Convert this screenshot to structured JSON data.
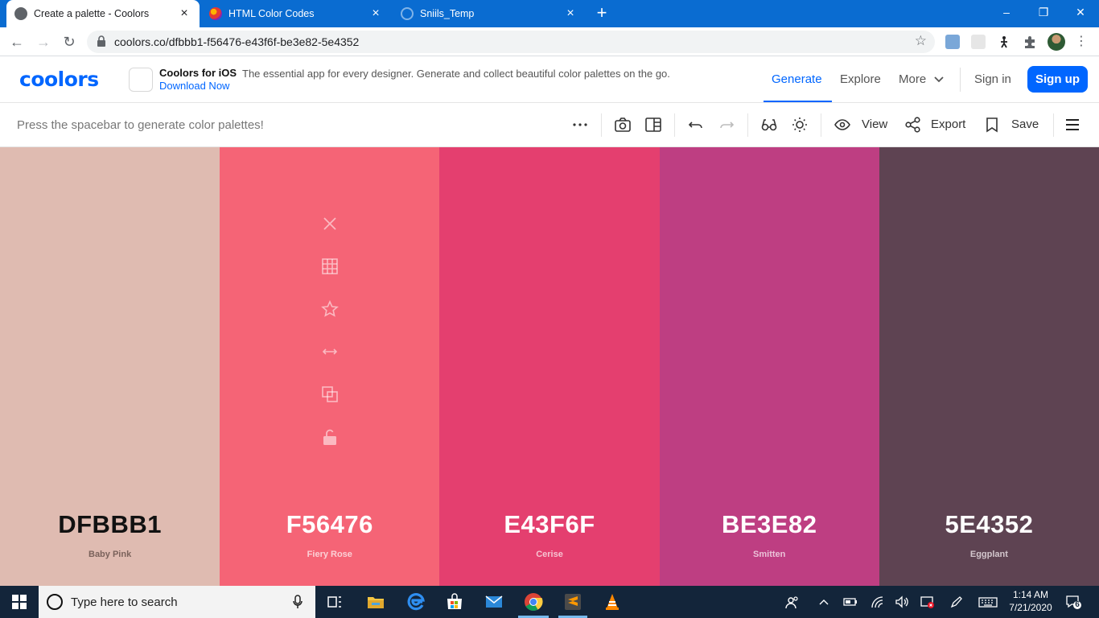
{
  "browser": {
    "tabs": [
      {
        "title": "Create a palette - Coolors",
        "active": true
      },
      {
        "title": "HTML Color Codes",
        "active": false
      },
      {
        "title": "Sniils_Temp",
        "active": false
      }
    ],
    "tab_close": "×",
    "new_tab": "+",
    "window_controls": {
      "minimize": "–",
      "restore": "❐",
      "close": "✕"
    },
    "url": "coolors.co/dfbbb1-f56476-e43f6f-be3e82-5e4352",
    "nav": {
      "back": "←",
      "forward": "→",
      "reload": "↻"
    },
    "bookmark_star": "☆",
    "menu": "⋮"
  },
  "header": {
    "logo": "coolors",
    "ios_promo": {
      "title": "Coolors for iOS",
      "description": "The essential app for every designer. Generate and collect beautiful color palettes on the go.",
      "link": "Download Now"
    },
    "nav": {
      "generate": "Generate",
      "explore": "Explore",
      "more": "More",
      "more_chevron": "⌄",
      "sign_in": "Sign in",
      "sign_up": "Sign up"
    }
  },
  "toolbar": {
    "hint": "Press the spacebar to generate color palettes!",
    "view": "View",
    "export": "Export",
    "save": "Save"
  },
  "palette": {
    "swatches": [
      {
        "hex": "DFBBB1",
        "name": "Baby Pink",
        "color": "#dfbbb1",
        "text_color": "#111111",
        "name_color": "#7a625b"
      },
      {
        "hex": "F56476",
        "name": "Fiery Rose",
        "color": "#f56476",
        "text_color": "#ffffff",
        "name_color": "#fbd0d6",
        "hovered": true
      },
      {
        "hex": "E43F6F",
        "name": "Cerise",
        "color": "#e43f6f",
        "text_color": "#ffffff",
        "name_color": "#f6c3d1"
      },
      {
        "hex": "BE3E82",
        "name": "Smitten",
        "color": "#be3e82",
        "text_color": "#ffffff",
        "name_color": "#ebc2d8"
      },
      {
        "hex": "5E4352",
        "name": "Eggplant",
        "color": "#5e4352",
        "text_color": "#ffffff",
        "name_color": "#d3c7cd"
      }
    ],
    "swatch_tools": [
      "close-icon",
      "grid-icon",
      "star-icon",
      "drag-icon",
      "copy-icon",
      "lock-icon"
    ]
  },
  "taskbar": {
    "search_placeholder": "Type here to search",
    "time": "1:14 AM",
    "date": "7/21/2020",
    "notification_count": "6"
  },
  "colors": {
    "accent": "#0066ff",
    "tabstrip": "#0a6cd1",
    "taskbar": "#13253a"
  }
}
